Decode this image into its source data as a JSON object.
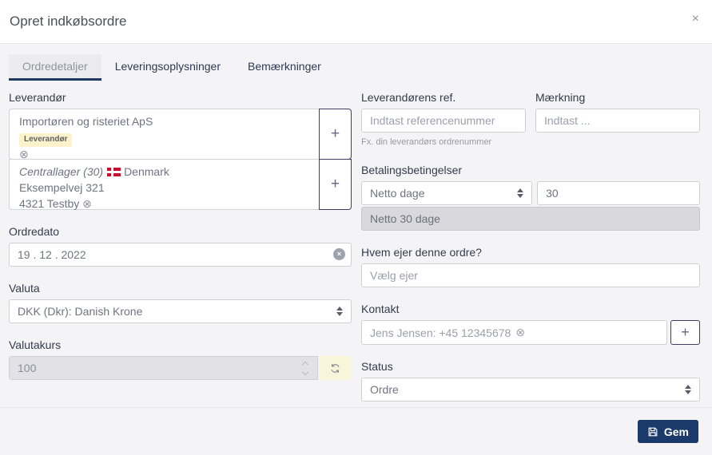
{
  "modal": {
    "title": "Opret indkøbsordre"
  },
  "icons": {
    "close": "×",
    "remove": "⊗",
    "plus": "+"
  },
  "tabs": [
    {
      "label": "Ordredetaljer",
      "active": true
    },
    {
      "label": "Leveringsoplysninger",
      "active": false
    },
    {
      "label": "Bemærkninger",
      "active": false
    }
  ],
  "form": {
    "supplier": {
      "label": "Leverandør",
      "company": {
        "name": "Importøren og risteriet ApS",
        "badge": "Leverandør"
      },
      "warehouse": {
        "name": "Centrallager (30)",
        "country": "Denmark",
        "address_line1": "Eksempelvej 321",
        "address_line2": "4321 Testby"
      }
    },
    "order_date": {
      "label": "Ordredato",
      "value": "19 . 12 . 2022"
    },
    "currency": {
      "label": "Valuta",
      "value": "DKK (Dkr): Danish Krone"
    },
    "exchange_rate": {
      "label": "Valutakurs",
      "value": "100"
    },
    "supplier_ref": {
      "label": "Leverandørens ref.",
      "placeholder": "Indtast referencenummer",
      "help": "Fx. din leverandørs ordrenummer"
    },
    "marking": {
      "label": "Mærkning",
      "placeholder": "Indtast ..."
    },
    "payment_terms": {
      "label": "Betalingsbetingelser",
      "type_value": "Netto dage",
      "days_value": "30",
      "summary": "Netto 30 dage"
    },
    "owner": {
      "label": "Hvem ejer denne ordre?",
      "placeholder": "Vælg ejer"
    },
    "contact": {
      "label": "Kontakt",
      "value": "Jens Jensen: +45 12345678"
    },
    "status": {
      "label": "Status",
      "value": "Ordre"
    }
  },
  "footer": {
    "save_label": "Gem"
  }
}
